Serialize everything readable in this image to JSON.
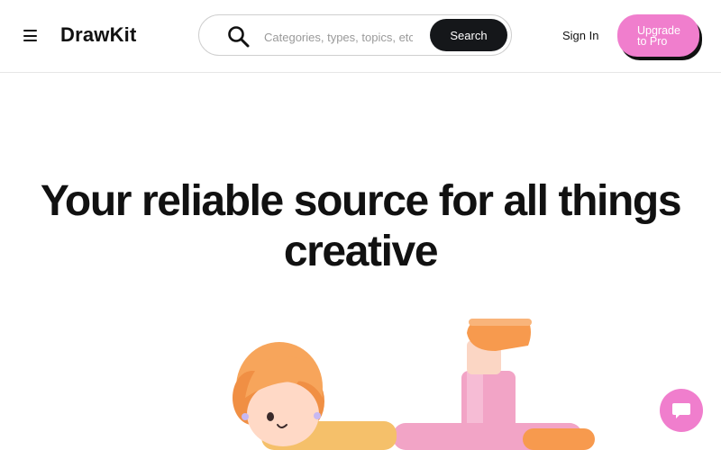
{
  "header": {
    "menu_icon": "hamburger-menu-icon",
    "logo": "DrawKit",
    "search": {
      "icon": "search-icon",
      "placeholder": "Categories, types, topics, etc",
      "button_label": "Search"
    },
    "sign_in_label": "Sign In",
    "upgrade": {
      "line1": "Upgrade",
      "line2": "to Pro"
    }
  },
  "hero": {
    "title": "Your reliable source for all things creative"
  },
  "chat": {
    "icon": "chat-bubble-icon"
  },
  "colors": {
    "accent_pink": "#f07ecd",
    "dark": "#15171a",
    "text": "#111111",
    "border": "#cfcfcf"
  }
}
